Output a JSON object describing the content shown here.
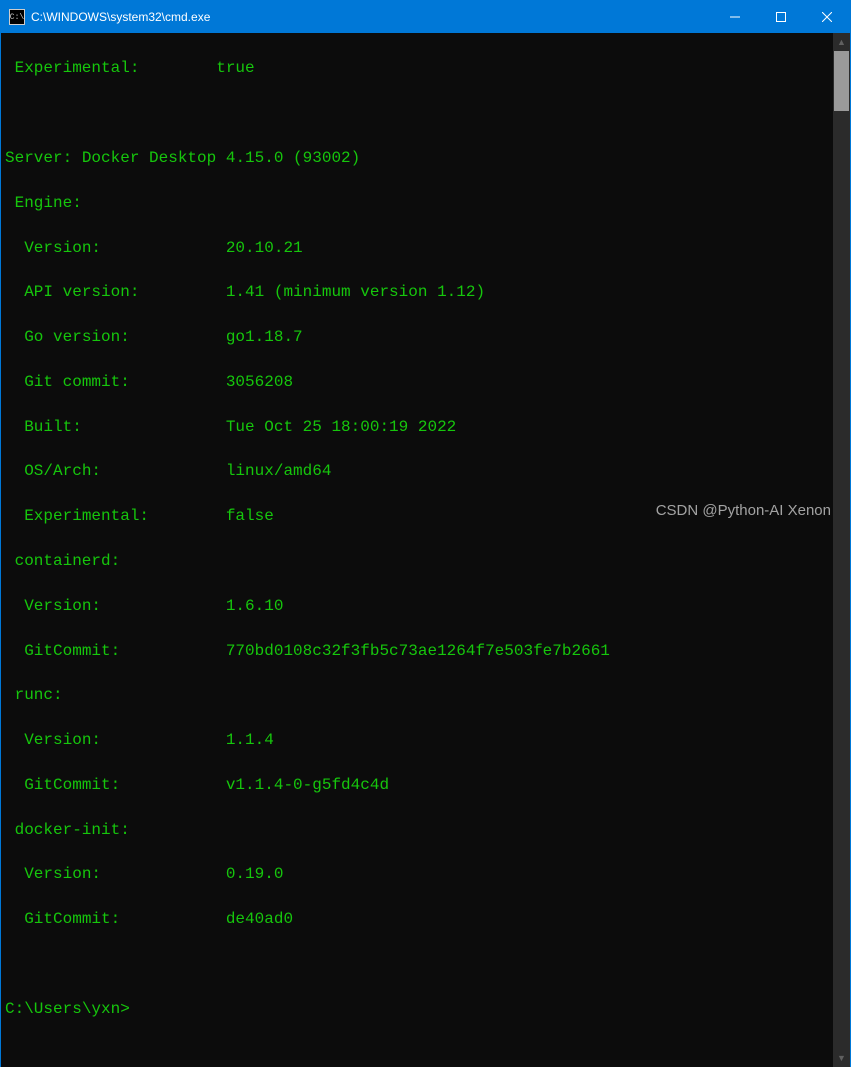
{
  "window": {
    "title": "C:\\WINDOWS\\system32\\cmd.exe",
    "icon_glyph": "C:\\"
  },
  "terminal": {
    "client_experimental": {
      "label": "Experimental:",
      "value": "true"
    },
    "server_line": "Server: Docker Desktop 4.15.0 (93002)",
    "engine": {
      "header": "Engine:",
      "version": {
        "label": "Version:",
        "value": "20.10.21"
      },
      "api_version": {
        "label": "API version:",
        "value": "1.41 (minimum version 1.12)"
      },
      "go_version": {
        "label": "Go version:",
        "value": "go1.18.7"
      },
      "git_commit": {
        "label": "Git commit:",
        "value": "3056208"
      },
      "built": {
        "label": "Built:",
        "value": "Tue Oct 25 18:00:19 2022"
      },
      "os_arch": {
        "label": "OS/Arch:",
        "value": "linux/amd64"
      },
      "experimental": {
        "label": "Experimental:",
        "value": "false"
      }
    },
    "containerd": {
      "header": "containerd:",
      "version": {
        "label": "Version:",
        "value": "1.6.10"
      },
      "git_commit": {
        "label": "GitCommit:",
        "value": "770bd0108c32f3fb5c73ae1264f7e503fe7b2661"
      }
    },
    "runc": {
      "header": "runc:",
      "version": {
        "label": "Version:",
        "value": "1.1.4"
      },
      "git_commit": {
        "label": "GitCommit:",
        "value": "v1.1.4-0-g5fd4c4d"
      }
    },
    "docker_init": {
      "header": "docker-init:",
      "version": {
        "label": "Version:",
        "value": "0.19.0"
      },
      "git_commit": {
        "label": "GitCommit:",
        "value": "de40ad0"
      }
    },
    "prompt": "C:\\Users\\yxn>"
  },
  "watermark": "CSDN @Python-AI Xenon"
}
